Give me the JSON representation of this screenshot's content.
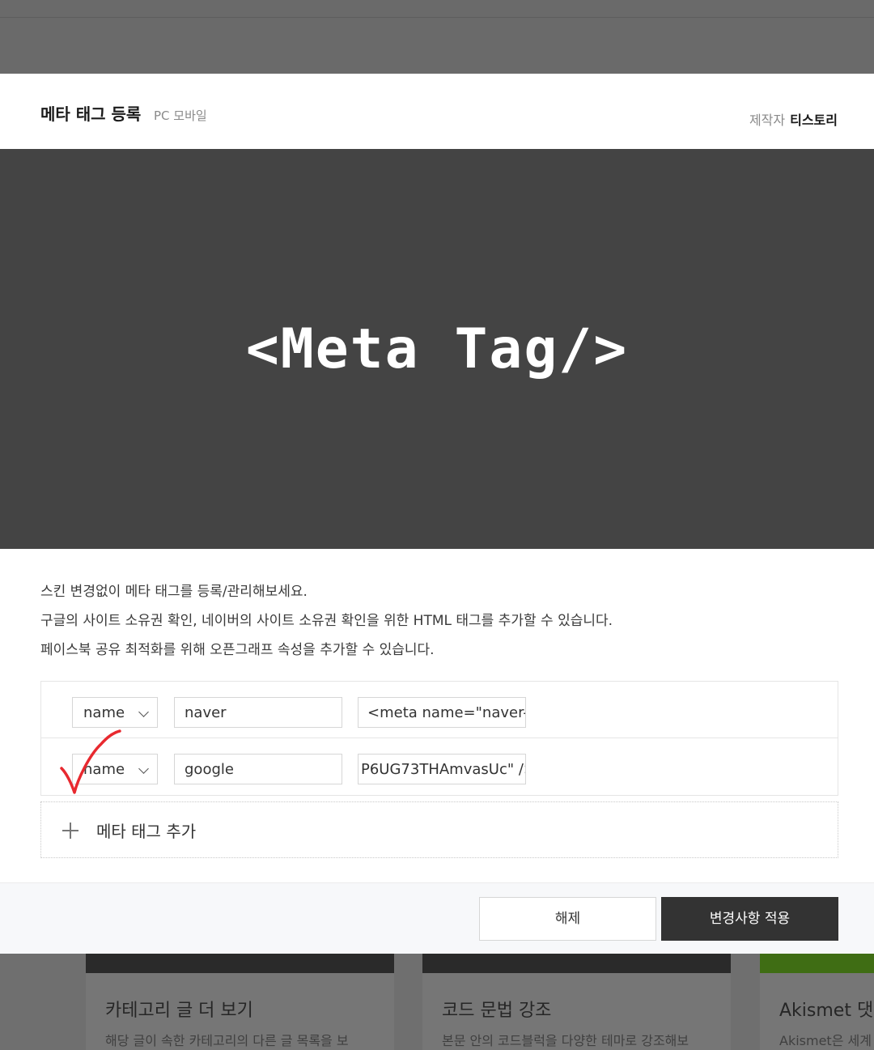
{
  "modal": {
    "title": "메타 태그 등록",
    "platforms": "PC 모바일",
    "maker_label": "제작자",
    "maker_name": "티스토리"
  },
  "banner": {
    "text": "<Meta Tag/>"
  },
  "description": [
    "스킨 변경없이 메타 태그를 등록/관리해보세요.",
    "구글의 사이트 소유권 확인, 네이버의 사이트 소유권 확인을 위한 HTML 태그를 추가할 수 있습니다.",
    "페이스북 공유 최적화를 위해 오픈그래프 속성을 추가할 수 있습니다."
  ],
  "meta_rows": [
    {
      "attribute": "name",
      "key": "naver",
      "value": "<meta name=\"naver-si"
    },
    {
      "attribute": "name",
      "key": "google",
      "value": "P6UG73THAmvasUc\" />"
    }
  ],
  "add_label": "메타 태그 추가",
  "buttons": {
    "reset": "해제",
    "apply": "변경사항 적용"
  },
  "background_cards": [
    {
      "title": "카테고리 글 더 보기",
      "desc": "해당 글이 속한 카테고리의 다른 글 목록을 보"
    },
    {
      "title": "코드 문법 강조",
      "desc": "본문 안의 코드블럭을 다양한 테마로 강조해보"
    },
    {
      "title": "Akismet 댓글",
      "desc": "Akismet은 세계"
    }
  ],
  "colors": {
    "banner_bg": "#444444",
    "apply_button": "#333333",
    "check_mark": "#e8292f"
  }
}
